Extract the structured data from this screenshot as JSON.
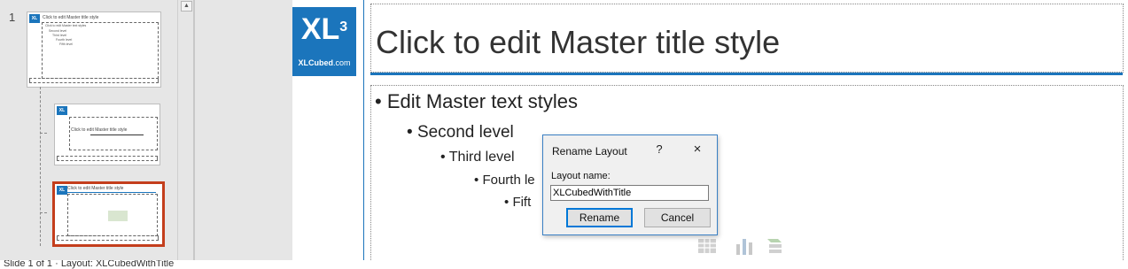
{
  "thumbnails": {
    "slide_number": "1",
    "master_title": "Click to edit Master title style",
    "master_body": [
      "Click to edit Master text styles",
      "Second level",
      "Third level",
      "Fourth level",
      "Fifth level"
    ],
    "layout1_title": "Click to edit Master title style",
    "layout2_title": "Click to edit Master title style"
  },
  "logo": {
    "main": "XL",
    "superscript": "3",
    "sub_bold": "XLCubed",
    "sub_light": ".com"
  },
  "slide": {
    "title": "Click to edit Master title style",
    "levels": [
      "Edit Master text styles",
      "Second level",
      "Third level",
      "Fourth le",
      "Fift"
    ],
    "bullets": [
      "•",
      "•",
      "•",
      "•",
      "•"
    ]
  },
  "dialog": {
    "title": "Rename Layout",
    "help": "?",
    "close": "×",
    "field_label": "Layout name:",
    "field_value": "XLCubedWithTitle",
    "rename_button": "Rename",
    "cancel_button": "Cancel"
  },
  "status_bar": {
    "text": "Slide 1 of 1 · Layout: XLCubedWithTitle"
  },
  "colors": {
    "brand_blue": "#1b75bc",
    "selection_red": "#c43e1c",
    "dialog_border": "#3a80c4"
  },
  "icons": [
    "insert-table-icon",
    "insert-chart-icon",
    "insert-smartart-icon"
  ]
}
